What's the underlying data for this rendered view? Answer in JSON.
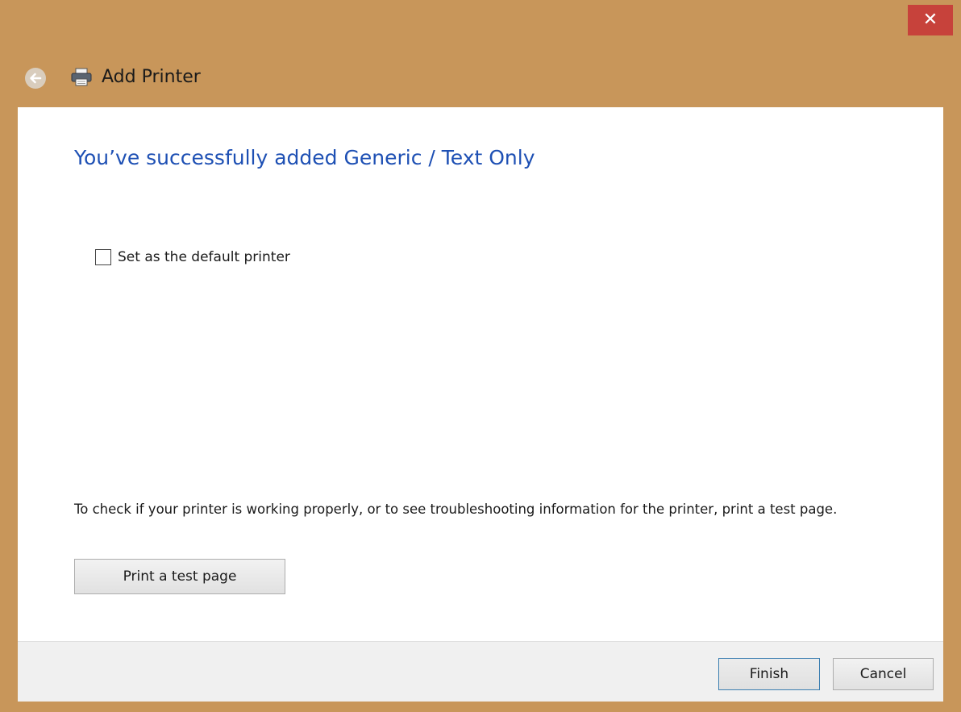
{
  "window": {
    "title": "Add Printer",
    "close_glyph": "✕",
    "accent_color": "#c8965a",
    "close_color": "#c7423b"
  },
  "icons": {
    "back": "back-arrow-icon",
    "printer": "printer-icon"
  },
  "main": {
    "heading": "You’ve successfully added Generic / Text Only",
    "heading_color": "#1e50b4",
    "default_checkbox": {
      "label": "Set as the default printer",
      "checked": false
    },
    "info_text": "To check if your printer is working properly, or to see troubleshooting information for the printer, print a test page.",
    "test_button_label": "Print a test page"
  },
  "footer": {
    "finish_label": "Finish",
    "cancel_label": "Cancel"
  }
}
